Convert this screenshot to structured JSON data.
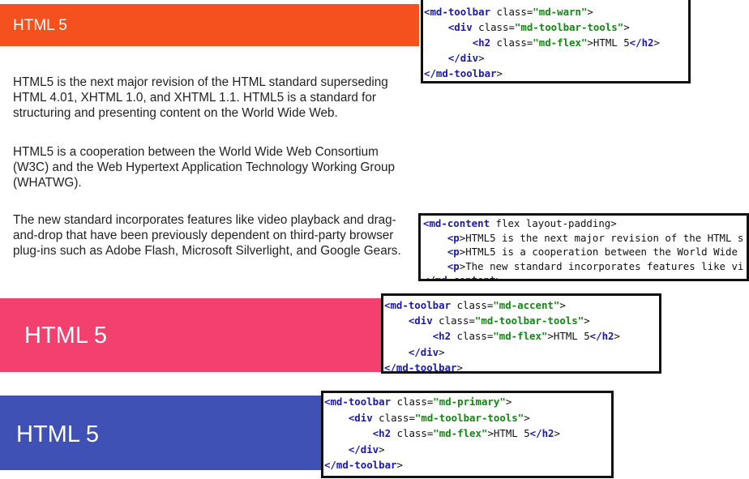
{
  "toolbar_warn": {
    "title": "HTML 5",
    "color": "#f4511e"
  },
  "content": {
    "paragraphs": [
      "HTML5 is the next major revision of the HTML standard superseding HTML 4.01, XHTML 1.0, and XHTML 1.1. HTML5 is a standard for structuring and presenting content on the World Wide Web.",
      "HTML5 is a cooperation between the World Wide Web Consortium (W3C) and the Web Hypertext Application Technology Working Group (WHATWG).",
      "The new standard incorporates features like video playback and drag-and-drop that have been previously dependent on third-party browser plug-ins such as Adobe Flash, Microsoft Silverlight, and Google Gears."
    ]
  },
  "toolbar_accent": {
    "title": "HTML 5",
    "color": "#f2406f"
  },
  "toolbar_primary": {
    "title": "HTML 5",
    "color": "#3f51b5"
  },
  "code_warn": [
    "<md-toolbar class=\"md-warn\">",
    "    <div class=\"md-toolbar-tools\">",
    "        <h2 class=\"md-flex\">HTML 5</h2>",
    "    </div>",
    "</md-toolbar>"
  ],
  "code_content": [
    "<md-content flex layout-padding>",
    "    <p>HTML5 is the next major revision of the HTML s",
    "    <p>HTML5 is a cooperation between the World Wide",
    "    <p>The new standard incorporates features like vi",
    "</md-content>"
  ],
  "code_accent": [
    "<md-toolbar class=\"md-accent\">",
    "    <div class=\"md-toolbar-tools\">",
    "        <h2 class=\"md-flex\">HTML 5</h2>",
    "    </div>",
    "</md-toolbar>"
  ],
  "code_primary": [
    "<md-toolbar class=\"md-primary\">",
    "    <div class=\"md-toolbar-tools\">",
    "        <h2 class=\"md-flex\">HTML 5</h2>",
    "    </div>",
    "</md-toolbar>"
  ]
}
